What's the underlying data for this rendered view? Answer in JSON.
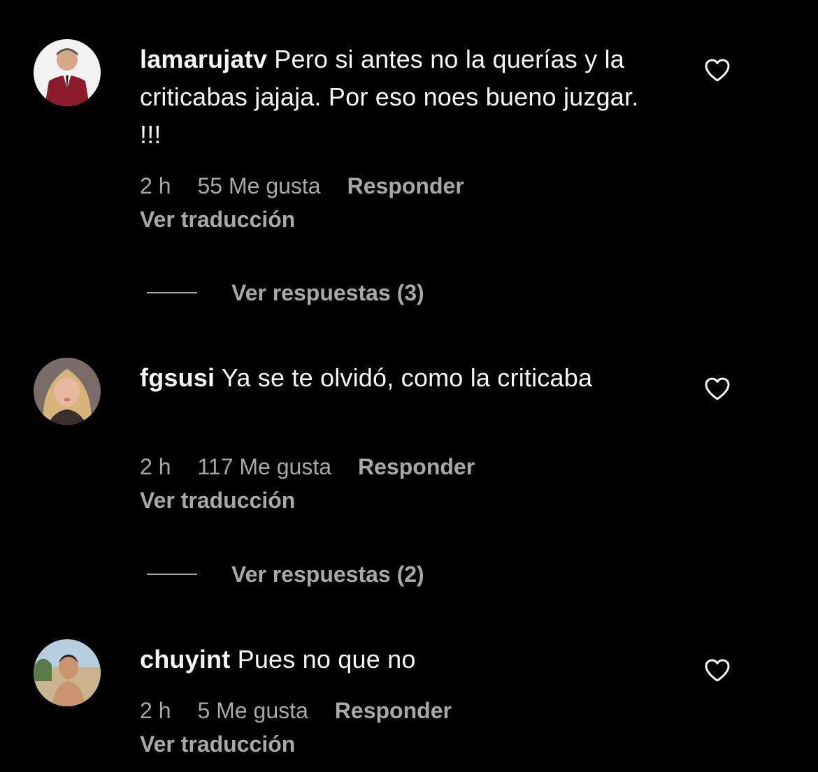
{
  "comments": [
    {
      "username": "lamarujatv",
      "text": "Pero si antes no la querías y la criticabas jajaja. Por eso noes bueno juzgar. !!!",
      "time": "2 h",
      "likes": "55 Me gusta",
      "reply_label": "Responder",
      "translate_label": "Ver traducción",
      "view_replies_label": "Ver respuestas (3)",
      "avatar_icon": "avatar-man-red-suit",
      "like_icon": "heart-outline-icon"
    },
    {
      "username": "fgsusi",
      "text": "Ya se te olvidó, como la criticaba",
      "time": "2 h",
      "likes": "117 Me gusta",
      "reply_label": "Responder",
      "translate_label": "Ver traducción",
      "view_replies_label": "Ver respuestas (2)",
      "avatar_icon": "avatar-woman-blonde",
      "like_icon": "heart-outline-icon"
    },
    {
      "username": "chuyint",
      "text": "Pues no que no",
      "time": "2 h",
      "likes": "5 Me gusta",
      "reply_label": "Responder",
      "translate_label": "Ver traducción",
      "avatar_icon": "avatar-man-outdoor",
      "like_icon": "heart-outline-icon"
    }
  ],
  "colors": {
    "background": "#000000",
    "primary_text": "#f5f5f5",
    "secondary_text": "#a8a8a8"
  }
}
